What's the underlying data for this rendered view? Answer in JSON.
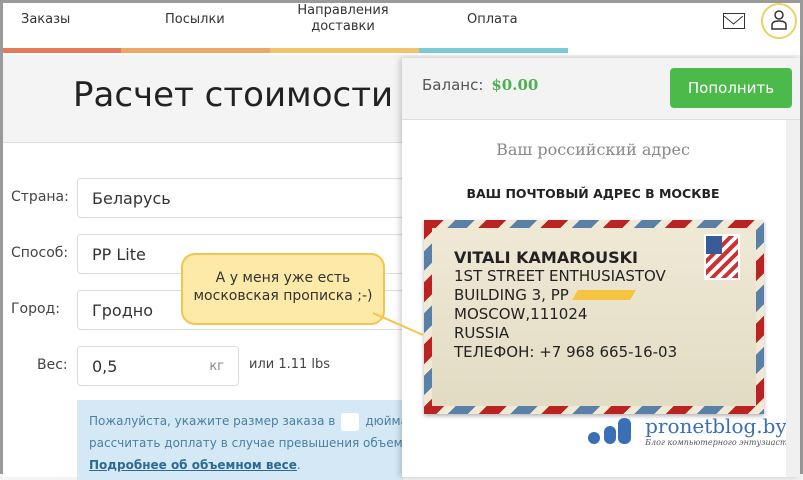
{
  "nav": {
    "items": [
      "Заказы",
      "Посылки",
      "Направления доставки",
      "Оплата"
    ]
  },
  "page": {
    "title": "Расчет стоимости до"
  },
  "form": {
    "country_label": "Страна:",
    "country": "Беларусь",
    "method_label": "Способ:",
    "method": "PP Lite",
    "city_label": "Город:",
    "city": "Гродно",
    "weight_label": "Вес:",
    "weight": "0,5",
    "weight_unit": "кг",
    "weight_lbs": "или 1.11 lbs",
    "info_line1a": "Пожалуйста, укажите размер заказа в",
    "info_line1b": "дюйма",
    "info_line2": "рассчитать доплату в случае превышения объемно",
    "info_link": "Подробнее об объемном весе",
    "info_dot": "."
  },
  "panel": {
    "balance_label": "Баланс:",
    "balance": "$0.00",
    "topup": "Пополнить",
    "subtitle": "Ваш российский адрес",
    "heading": "ВАШ ПОЧТОВЫЙ АДРЕС В МОСКВЕ",
    "address": {
      "name": "VITALI KAMAROUSKI",
      "line1": "1ST STREET ENTHUSIASTOV",
      "line2": "BUILDING 3, PP",
      "line3": "MOSCOW,111024",
      "line4": "RUSSIA",
      "phone": "ТЕЛЕФОН: +7 968 665-16-03"
    }
  },
  "callout": "А у меня уже есть московская прописка ;-)",
  "watermark": {
    "site": "pronetblog.by",
    "tagline": "Блог компьютерного энтузиаста"
  },
  "colors": {
    "green": "#4cba4a",
    "strip": [
      "#e57a5a",
      "#eea865",
      "#f1c46c",
      "#7ccad6"
    ]
  }
}
